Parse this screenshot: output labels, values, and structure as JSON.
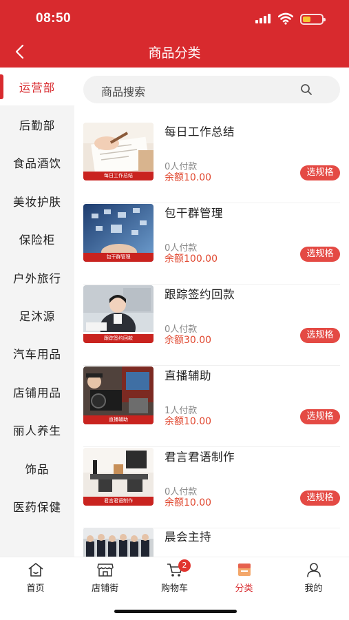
{
  "status_bar": {
    "time": "08:50"
  },
  "nav": {
    "title": "商品分类"
  },
  "sidebar": {
    "items": [
      {
        "label": "运营部",
        "active": true
      },
      {
        "label": "后勤部"
      },
      {
        "label": "食品酒饮"
      },
      {
        "label": "美妆护肤"
      },
      {
        "label": "保险柜"
      },
      {
        "label": "户外旅行"
      },
      {
        "label": "足沐源"
      },
      {
        "label": "汽车用品"
      },
      {
        "label": "店铺用品"
      },
      {
        "label": "丽人养生"
      },
      {
        "label": "饰品"
      },
      {
        "label": "医药保健"
      }
    ]
  },
  "search": {
    "placeholder": "商品搜索"
  },
  "products": [
    {
      "name": "每日工作总结",
      "paid": "0人付款",
      "price": "余额10.00",
      "button": "选规格",
      "thumb_caption": "每日工作总结"
    },
    {
      "name": "包干群管理",
      "paid": "0人付款",
      "price": "余额100.00",
      "button": "选规格",
      "thumb_caption": "包干群管理"
    },
    {
      "name": "跟踪签约回款",
      "paid": "0人付款",
      "price": "余额30.00",
      "button": "选规格",
      "thumb_caption": "跟踪签约回款"
    },
    {
      "name": "直播辅助",
      "paid": "1人付款",
      "price": "余额10.00",
      "button": "选规格",
      "thumb_caption": "直播辅助"
    },
    {
      "name": "君言君语制作",
      "paid": "0人付款",
      "price": "余额10.00",
      "button": "选规格",
      "thumb_caption": "君言君语制作"
    },
    {
      "name": "晨会主持"
    }
  ],
  "tabbar": {
    "items": [
      {
        "label": "首页",
        "icon": "home-icon"
      },
      {
        "label": "店铺街",
        "icon": "store-icon"
      },
      {
        "label": "购物车",
        "icon": "cart-icon",
        "badge": "2"
      },
      {
        "label": "分类",
        "icon": "category-icon",
        "active": true
      },
      {
        "label": "我的",
        "icon": "user-icon"
      }
    ]
  },
  "colors": {
    "brand": "#d82a2e",
    "price": "#e0472f",
    "button": "#e44a44"
  }
}
